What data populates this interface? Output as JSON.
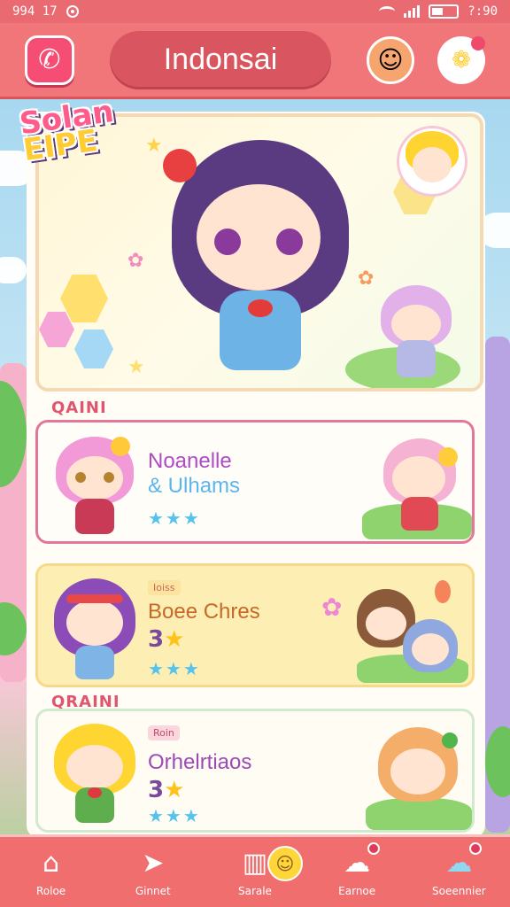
{
  "status_bar": {
    "left_text": "994 17",
    "right_text": "?:90"
  },
  "header": {
    "title": "Indonsai"
  },
  "hero": {
    "logo_line1": "Solan",
    "logo_line2": "EIPE"
  },
  "sections": [
    {
      "label": "QAINI"
    },
    {
      "label": "QRAINI"
    }
  ],
  "cards": [
    {
      "title_line1": "Noanelle",
      "title_line2": "& Ulhams",
      "stars": "★★★",
      "title_color": "#b04bc8",
      "accent_color": "#5bb6ee"
    },
    {
      "tag": "Ioiss",
      "title": "Boee Chres",
      "level": "3",
      "stars": "★★★",
      "title_color": "#c66a2a"
    },
    {
      "tag": "Roin",
      "title": "Orhelrtiaos",
      "level": "3",
      "stars": "★★★",
      "title_color": "#9a4bb8"
    }
  ],
  "nav": [
    {
      "label": "Roloe",
      "icon": "home-icon"
    },
    {
      "label": "Ginnet",
      "icon": "arrow-icon"
    },
    {
      "label": "Sarale",
      "icon": "store-icon"
    },
    {
      "label": "Earnoe",
      "icon": "user-icon"
    },
    {
      "label": "Soeennier",
      "icon": "cloud-icon"
    }
  ],
  "colors": {
    "header_bg": "#f0767a",
    "title_pill": "#d95660",
    "nav_bg": "#f06e6e",
    "card1_border": "#e2779a",
    "card2_bg": "#fdeeb3"
  }
}
